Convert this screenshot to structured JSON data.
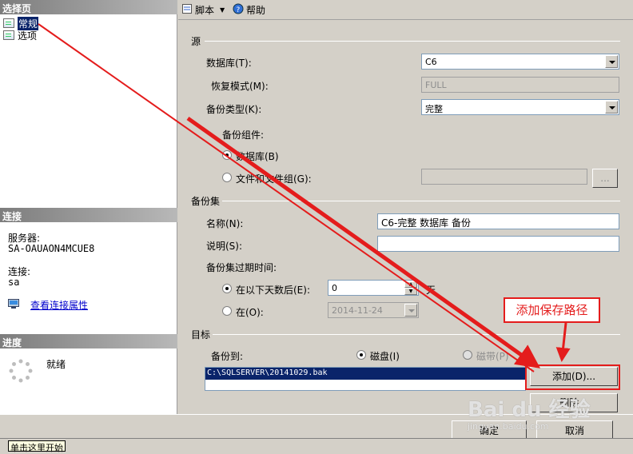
{
  "left": {
    "select_page_header": "选择页",
    "pages": [
      {
        "label": "常规",
        "selected": true
      },
      {
        "label": "选项",
        "selected": false
      }
    ],
    "connection_header": "连接",
    "server_label": "服务器:",
    "server_value": "SA-OAUAON4MCUE8",
    "connection_label": "连接:",
    "connection_value": "sa",
    "view_props_link": "查看连接属性",
    "progress_header": "进度",
    "progress_status": "就绪"
  },
  "toolbar": {
    "script_label": "脚本",
    "help_label": "帮助"
  },
  "source": {
    "title": "源",
    "database_label": "数据库(T):",
    "database_value": "C6",
    "recovery_label": "恢复模式(M):",
    "recovery_value": "FULL",
    "backup_type_label": "备份类型(K):",
    "backup_type_value": "完整",
    "component_label": "备份组件:",
    "radio_database": "数据库(B)",
    "radio_files": "文件和文件组(G):",
    "browse_label": "..."
  },
  "backup_set": {
    "title": "备份集",
    "name_label": "名称(N):",
    "name_value": "C6-完整 数据库 备份",
    "desc_label": "说明(S):",
    "desc_value": "",
    "expire_label": "备份集过期时间:",
    "after_days_label": "在以下天数后(E):",
    "days_value": "0",
    "days_unit": "天",
    "on_label": "在(O):",
    "on_value": "2014-11-24"
  },
  "destination": {
    "title": "目标",
    "backup_to_label": "备份到:",
    "disk_label": "磁盘(I)",
    "tape_label": "磁带(P)",
    "path_value": "C:\\SQLSERVER\\20141029.bak",
    "add_button": "添加(D)...",
    "remove_button": "删除..."
  },
  "annotation": {
    "text": "添加保存路径"
  },
  "footer": {
    "ok_button": "确定",
    "cancel_button": "取消"
  },
  "status": {
    "start_tip": "单击这里开始"
  },
  "watermark": {
    "text": "Bai du 经验",
    "sub": "jingyan.baidu.com"
  },
  "colors": {
    "arrow_red": "#e41c1c",
    "selection_blue": "#0a246a"
  }
}
